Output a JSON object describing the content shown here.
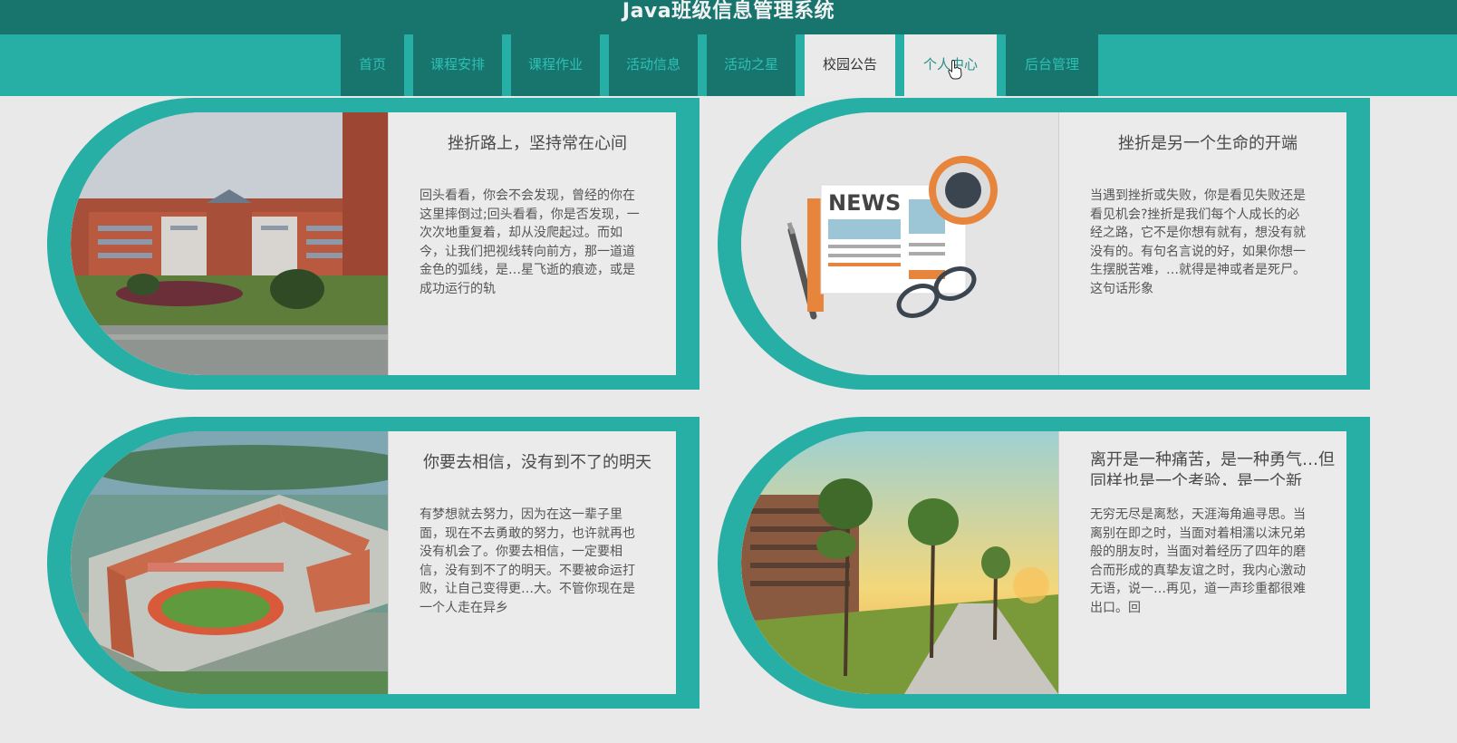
{
  "app": {
    "title": "Java班级信息管理系统"
  },
  "nav": {
    "items": [
      {
        "label": "首页"
      },
      {
        "label": "课程安排"
      },
      {
        "label": "课程作业"
      },
      {
        "label": "活动信息"
      },
      {
        "label": "活动之星"
      },
      {
        "label": "校园公告"
      },
      {
        "label": "个人中心"
      },
      {
        "label": "后台管理"
      }
    ],
    "active_index": 5,
    "hover_index": 6
  },
  "articles": [
    {
      "title": "挫折路上，坚持常在心间",
      "body": "回头看看，你会不会发现，曾经的你在这里摔倒过;回头看看，你是否发现，一次次地重复着，却从没爬起过。而如今，让我们把视线转向前方，那一道道金色的弧线，是…星飞逝的痕迹，或是成功运行的轨"
    },
    {
      "title": "挫折是另一个生命的开端",
      "body": "当遇到挫折或失败，你是看见失败还是看见机会?挫折是我们每个人成长的必经之路，它不是你想有就有，想没有就没有的。有句名言说的好，如果你想一生摆脱苦难，…就得是神或者是死尸。这句话形象",
      "image_text": "NEWS"
    },
    {
      "title": "你要去相信，没有到不了的明天",
      "body": "有梦想就去努力，因为在这一辈子里面，现在不去勇敢的努力，也许就再也没有机会了。你要去相信，一定要相信，没有到不了的明天。不要被命运打败，让自己变得更…大。不管你现在是一个人走在异乡"
    },
    {
      "title": "离开是一种痛苦，是一种勇气…但同样也是一个考验，是一个新",
      "body": "无穷无尽是离愁，天涯海角遍寻思。当离别在即之时，当面对着相濡以沫兄弟般的朋友时，当面对着经历了四年的磨合而形成的真挚友谊之时，我内心激动无语，说一…再见，道一声珍重都很难出口。回"
    }
  ]
}
